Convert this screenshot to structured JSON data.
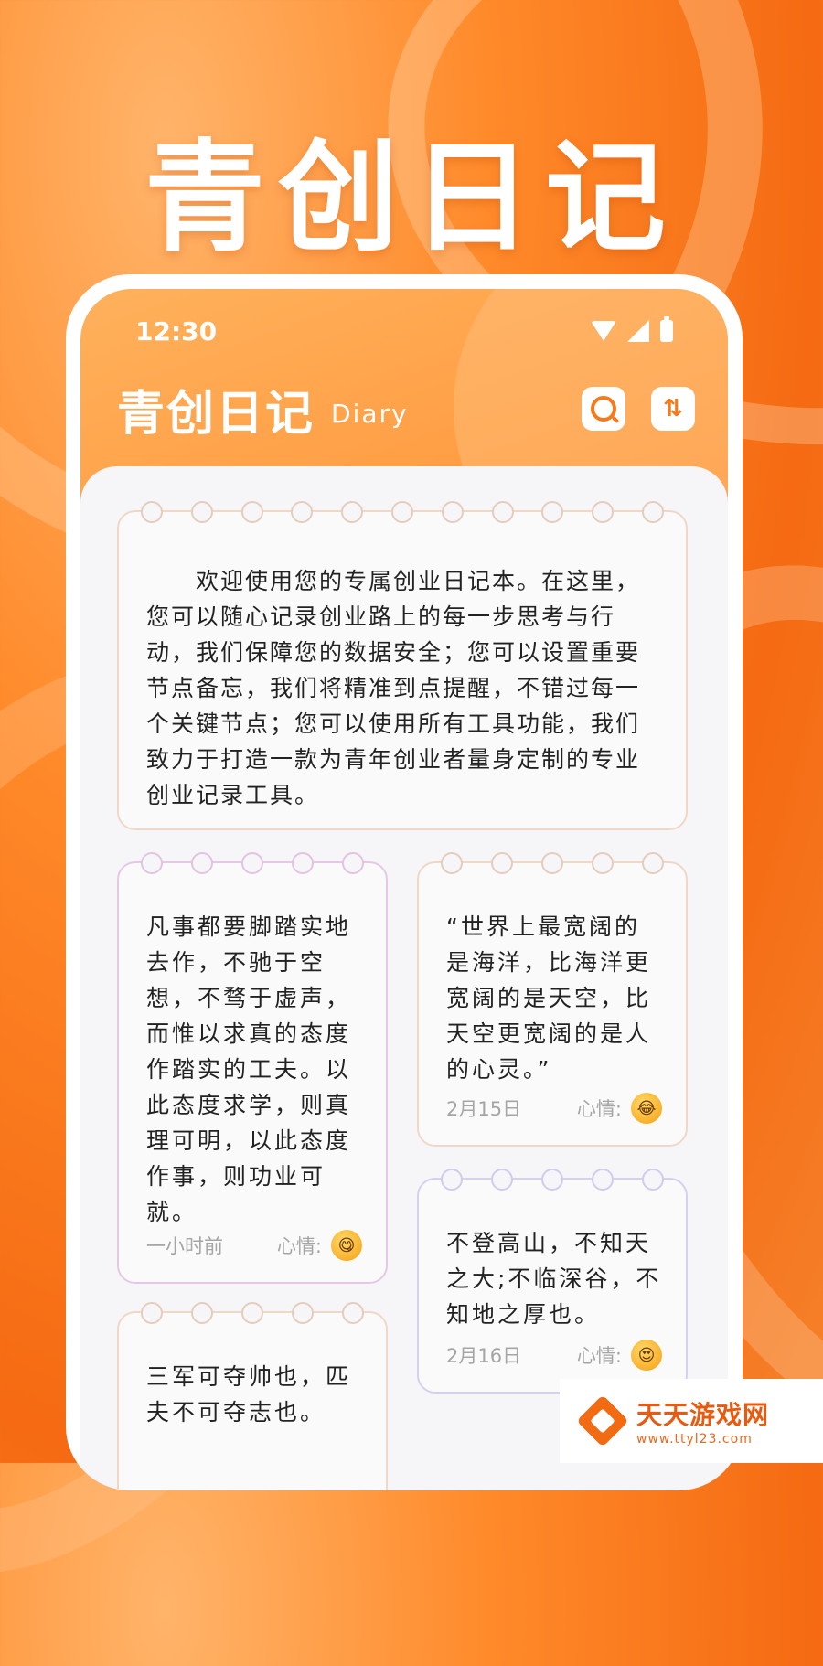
{
  "hero_title": "青创日记",
  "status_bar": {
    "time": "12:30"
  },
  "app_header": {
    "title": "青创日记",
    "subtitle": "Diary",
    "search_icon": "search-icon",
    "sort_icon": "sort-icon",
    "sort_glyph": "⇅"
  },
  "notes": {
    "welcome": {
      "text": "　　欢迎使用您的专属创业日记本。在这里，您可以随心记录创业路上的每一步思考与行动，我们保障您的数据安全；您可以设置重要节点备忘，我们将精准到点提醒，不错过每一个关键节点；您可以使用所有工具功能，我们致力于打造一款为青年创业者量身定制的专业创业记录工具。"
    },
    "left": [
      {
        "text": "凡事都要脚踏实地去作，不驰于空想，不骛于虚声，而惟以求真的态度作踏实的工夫。以此态度求学，则真理可明，以此态度作事，则功业可就。",
        "time": "一小时前",
        "mood_label": "心情:",
        "mood_icon": "tongue-out-emoji-icon",
        "mood_glyph": "😋"
      },
      {
        "text": "三军可夺帅也，匹夫不可夺志也。"
      }
    ],
    "right": [
      {
        "text": "“世界上最宽阔的是海洋，比海洋更宽阔的是天空，比天空更宽阔的是人的心灵。”",
        "time": "2月15日",
        "mood_label": "心情:",
        "mood_icon": "laughing-tears-emoji-icon",
        "mood_glyph": "😂"
      },
      {
        "text": "不登高山，不知天之大;不临深谷，不知地之厚也。",
        "time": "2月16日",
        "mood_label": "心情:",
        "mood_icon": "heart-eyes-emoji-icon",
        "mood_glyph": "😍"
      }
    ]
  },
  "watermark": {
    "name": "天天游戏网",
    "url": "www.ttyl23.com"
  },
  "colors": {
    "accent": "#f57a1c",
    "background_orange": "#ff8a2a",
    "card_bg": "#fbfafb"
  }
}
